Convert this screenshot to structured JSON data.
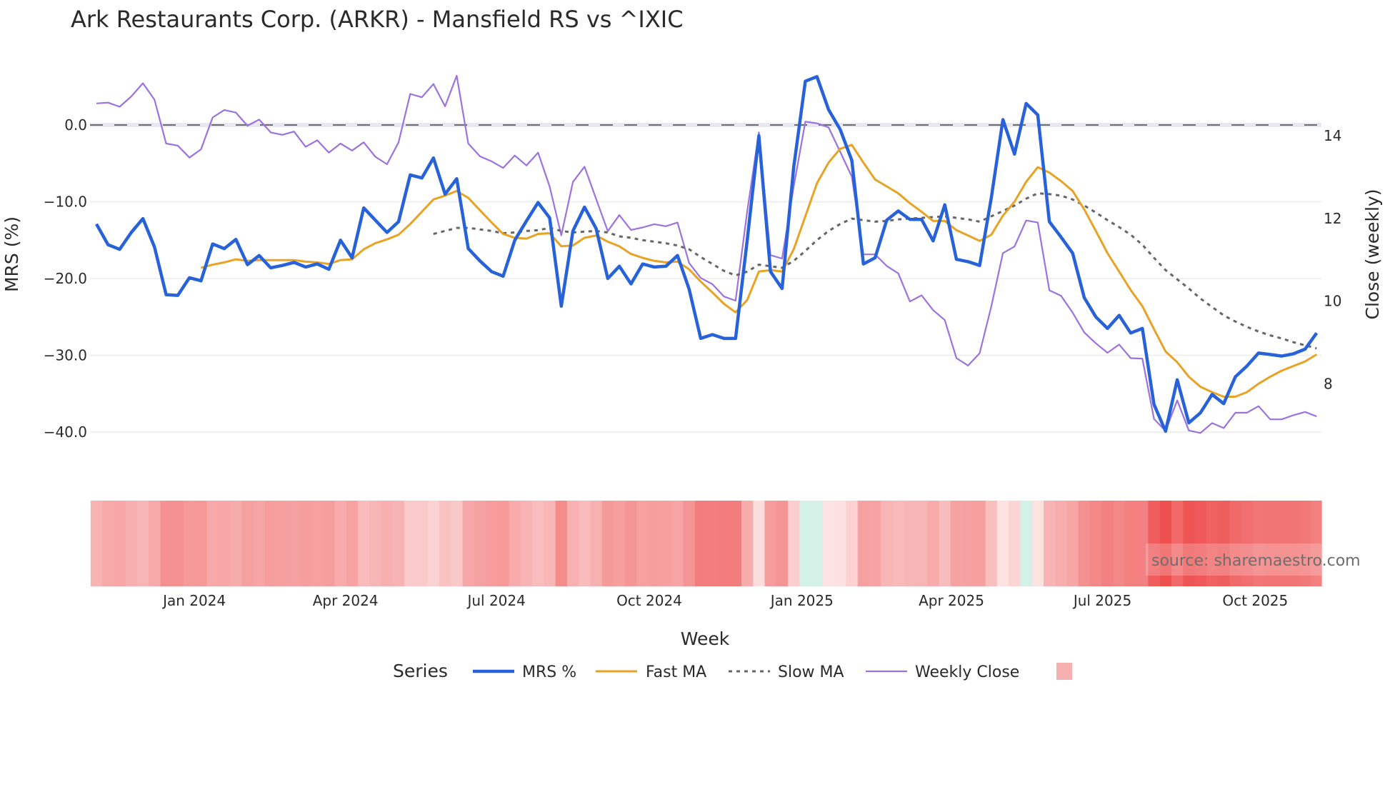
{
  "chart_data": {
    "type": "line",
    "title": "Ark Restaurants Corp. (ARKR) - Mansfield RS vs ^IXIC",
    "xlabel": "Week",
    "ylabel": "MRS (%)",
    "y2label": "Close (weekly)",
    "x_start": "2023-11-03",
    "x_step_days": 7,
    "ylim": [
      -41.5,
      8
    ],
    "y_ticks": [
      0,
      -10,
      -20,
      -30,
      -40
    ],
    "y_tick_labels": [
      "0.0",
      "−10.0",
      "−20.0",
      "−30.0",
      "−40.0"
    ],
    "y2_ticks": [
      14,
      12,
      10,
      8
    ],
    "y2_tick_labels": [
      "14",
      "12",
      "10",
      "8"
    ],
    "x_ticks": [
      {
        "date": "2024-01-01",
        "label": "Jan 2024"
      },
      {
        "date": "2024-04-01",
        "label": "Apr 2024"
      },
      {
        "date": "2024-07-01",
        "label": "Jul 2024"
      },
      {
        "date": "2024-10-01",
        "label": "Oct 2024"
      },
      {
        "date": "2025-01-01",
        "label": "Jan 2025"
      },
      {
        "date": "2025-04-01",
        "label": "Apr 2025"
      },
      {
        "date": "2025-07-01",
        "label": "Jul 2025"
      },
      {
        "date": "2025-10-01",
        "label": "Oct 2025"
      }
    ],
    "reference_line": 0,
    "grid": true,
    "legend_title": "Series",
    "legend_position": "bottom",
    "series": [
      {
        "name": "MRS %",
        "axis": "y",
        "color": "#2862d9",
        "style": "solid",
        "start_index": 0,
        "values": [
          -12.9,
          -15.6,
          -16.2,
          -14.0,
          -12.2,
          -15.9,
          -22.1,
          -22.2,
          -19.9,
          -20.3,
          -15.5,
          -16.1,
          -14.9,
          -18.2,
          -17.0,
          -18.6,
          -18.3,
          -17.9,
          -18.5,
          -18.1,
          -18.8,
          -15.0,
          -17.3,
          -10.8,
          -12.4,
          -14.0,
          -12.6,
          -6.5,
          -6.9,
          -4.3,
          -9.0,
          -7.0,
          -16.1,
          -17.7,
          -19.1,
          -19.7,
          -15.0,
          -12.5,
          -10.1,
          -12.1,
          -23.6,
          -13.8,
          -10.7,
          -13.5,
          -20.0,
          -18.4,
          -20.7,
          -18.1,
          -18.5,
          -18.4,
          -17.0,
          -21.4,
          -27.8,
          -27.3,
          -27.8,
          -27.8,
          -15.0,
          -1.4,
          -19.1,
          -21.3,
          -5.5,
          5.7,
          6.3,
          2.0,
          -0.6,
          -4.6,
          -18.1,
          -17.3,
          -12.4,
          -11.2,
          -12.3,
          -12.3,
          -15.1,
          -10.4,
          -17.5,
          -17.8,
          -18.3,
          -9.5,
          0.7,
          -3.8,
          2.8,
          1.3,
          -12.6,
          -14.6,
          -16.7,
          -22.5,
          -25.0,
          -26.5,
          -24.8,
          -27.1,
          -26.5,
          -36.4,
          -39.9,
          -33.2,
          -38.8,
          -37.5,
          -35.1,
          -36.3,
          -32.8,
          -31.4,
          -29.7,
          -29.9,
          -30.1,
          -29.8,
          -29.2,
          -27.1
        ]
      },
      {
        "name": "Fast MA",
        "axis": "y",
        "color": "#e8a325",
        "style": "solid",
        "start_index": 9,
        "values": [
          -18.6,
          -18.2,
          -17.9,
          -17.5,
          -17.7,
          -17.6,
          -17.6,
          -17.6,
          -17.6,
          -17.8,
          -17.9,
          -18.1,
          -17.6,
          -17.5,
          -16.2,
          -15.4,
          -14.9,
          -14.3,
          -12.9,
          -11.3,
          -9.7,
          -9.2,
          -8.6,
          -9.5,
          -11.1,
          -12.7,
          -14.2,
          -14.7,
          -14.8,
          -14.2,
          -14.1,
          -15.8,
          -15.7,
          -14.7,
          -14.4,
          -15.2,
          -15.8,
          -16.8,
          -17.3,
          -17.7,
          -17.9,
          -17.8,
          -18.8,
          -20.4,
          -21.8,
          -23.3,
          -24.4,
          -22.8,
          -19.1,
          -18.9,
          -19.1,
          -16.2,
          -11.9,
          -7.6,
          -4.9,
          -3.1,
          -2.6,
          -4.9,
          -7.1,
          -8.0,
          -8.9,
          -10.2,
          -11.3,
          -12.5,
          -12.5,
          -13.7,
          -14.4,
          -15.1,
          -14.3,
          -11.8,
          -10.0,
          -7.4,
          -5.5,
          -6.2,
          -7.3,
          -8.6,
          -11.0,
          -13.8,
          -16.7,
          -19.1,
          -21.5,
          -23.6,
          -26.6,
          -29.5,
          -30.9,
          -32.8,
          -34.1,
          -34.8,
          -35.4,
          -35.4,
          -34.8,
          -33.7,
          -32.8,
          -32.0,
          -31.4,
          -30.8,
          -29.9
        ]
      },
      {
        "name": "Slow MA",
        "axis": "y",
        "color": "#666666",
        "style": "dot",
        "start_index": 29,
        "values": [
          -14.2,
          -13.8,
          -13.4,
          -13.4,
          -13.6,
          -13.8,
          -14.1,
          -14.0,
          -13.8,
          -13.7,
          -13.4,
          -13.8,
          -14.0,
          -13.9,
          -13.8,
          -14.0,
          -14.5,
          -14.7,
          -15.0,
          -15.2,
          -15.4,
          -15.7,
          -16.2,
          -17.2,
          -18.1,
          -19.0,
          -19.6,
          -19.1,
          -18.2,
          -18.4,
          -18.6,
          -17.7,
          -16.4,
          -15.0,
          -13.8,
          -12.9,
          -12.2,
          -12.4,
          -12.6,
          -12.5,
          -12.3,
          -12.2,
          -12.1,
          -12.0,
          -11.9,
          -12.1,
          -12.3,
          -12.6,
          -11.9,
          -11.2,
          -10.5,
          -9.6,
          -8.9,
          -9.0,
          -9.2,
          -9.7,
          -10.5,
          -11.4,
          -12.4,
          -13.3,
          -14.3,
          -15.6,
          -17.3,
          -18.9,
          -20.1,
          -21.3,
          -22.6,
          -23.7,
          -24.8,
          -25.6,
          -26.3,
          -26.9,
          -27.4,
          -27.8,
          -28.3,
          -28.7,
          -29.1
        ]
      },
      {
        "name": "Weekly Close",
        "axis": "y2",
        "color": "#9b72e0",
        "style": "solid",
        "start_index": 0,
        "values": [
          14.78,
          14.8,
          14.7,
          14.95,
          15.27,
          14.87,
          13.81,
          13.76,
          13.47,
          13.67,
          14.44,
          14.62,
          14.56,
          14.24,
          14.39,
          14.08,
          14.02,
          14.1,
          13.73,
          13.89,
          13.59,
          13.81,
          13.64,
          13.84,
          13.49,
          13.31,
          13.84,
          15.01,
          14.93,
          15.25,
          14.71,
          15.45,
          13.81,
          13.5,
          13.38,
          13.22,
          13.52,
          13.28,
          13.59,
          12.77,
          11.59,
          12.88,
          13.25,
          12.47,
          11.69,
          12.08,
          11.72,
          11.78,
          11.86,
          11.81,
          11.9,
          10.92,
          10.56,
          10.41,
          10.11,
          10.01,
          12.17,
          14.08,
          11.11,
          11.03,
          12.77,
          14.34,
          14.3,
          14.2,
          13.61,
          13.01,
          11.13,
          11.13,
          10.85,
          10.67,
          9.99,
          10.14,
          9.78,
          9.54,
          8.62,
          8.44,
          8.74,
          9.87,
          11.16,
          11.32,
          11.95,
          11.9,
          10.26,
          10.13,
          9.72,
          9.24,
          8.98,
          8.75,
          8.95,
          8.62,
          8.61,
          7.15,
          6.86,
          7.6,
          6.87,
          6.81,
          7.05,
          6.93,
          7.3,
          7.3,
          7.46,
          7.14,
          7.14,
          7.24,
          7.32,
          7.21
        ]
      }
    ],
    "heatmap": {
      "source_series": "MRS %",
      "negative_color": "#ee5050",
      "neutral_color": "#fde2e2",
      "positive_color": "#d3f1e6"
    },
    "legend_swatch_color": "#f7b0b0",
    "watermark": "source: sharemaestro.com"
  }
}
